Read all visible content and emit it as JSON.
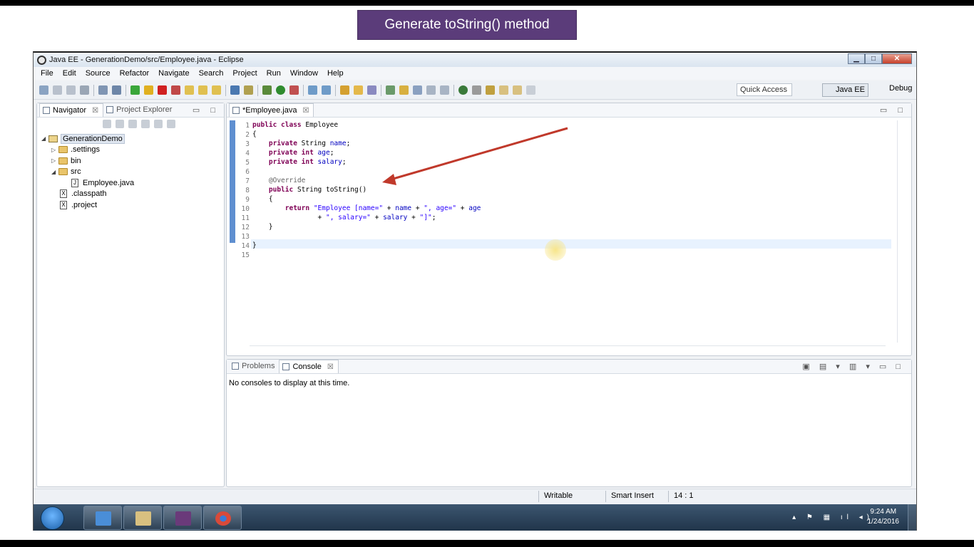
{
  "banner": {
    "text": "Generate toString() method"
  },
  "window": {
    "title": "Java EE - GenerationDemo/src/Employee.java - Eclipse"
  },
  "menu": [
    "File",
    "Edit",
    "Source",
    "Refactor",
    "Navigate",
    "Search",
    "Project",
    "Run",
    "Window",
    "Help"
  ],
  "toolbar": {
    "quick_access": "Quick Access",
    "perspective_active": "Java EE",
    "perspective_other": "Debug"
  },
  "navigator": {
    "tabs": [
      {
        "label": "Navigator",
        "close": "☒"
      },
      {
        "label": "Project Explorer"
      }
    ],
    "tree": {
      "project": "GenerationDemo",
      "settings": ".settings",
      "bin": "bin",
      "src": "src",
      "employee_file": "Employee.java",
      "classpath": ".classpath",
      "project_file": ".project"
    }
  },
  "editor": {
    "tab": {
      "label": "*Employee.java",
      "close": "☒"
    },
    "line_numbers": [
      "1",
      "2",
      "3",
      "4",
      "5",
      "6",
      "7",
      "8",
      "9",
      "10",
      "11",
      "12",
      "13",
      "14",
      "15"
    ],
    "code": {
      "l1a": "public class",
      "l1b": " Employee",
      "l2": "{",
      "l3a": "private",
      "l3b": " String ",
      "l3c": "name",
      "l3d": ";",
      "l4a": "private int",
      "l4c": "age",
      "l4d": ";",
      "l5a": "private int",
      "l5c": "salary",
      "l5d": ";",
      "l7": "@Override",
      "l8a": "public",
      "l8b": " String toString()",
      "l9": "{",
      "l10a": "return",
      "l10b": "\"Employee [name=\"",
      "l10c": " + ",
      "l10d": "name",
      "l10e": " + ",
      "l10f": "\", age=\"",
      "l10g": " + ",
      "l10h": "age",
      "l11a": "+ ",
      "l11b": "\", salary=\"",
      "l11c": " + ",
      "l11d": "salary",
      "l11e": " + ",
      "l11f": "\"]\"",
      "l11g": ";",
      "l12": "}",
      "l14": "}"
    }
  },
  "console": {
    "tabs": [
      {
        "label": "Problems"
      },
      {
        "label": "Console",
        "close": "☒"
      }
    ],
    "message": "No consoles to display at this time."
  },
  "status": {
    "writable": "Writable",
    "insert_mode": "Smart Insert",
    "position": "14 : 1"
  },
  "taskbar": {
    "time": "9:24 AM",
    "date": "1/24/2016"
  },
  "colors": {
    "banner_bg": "#5b3c7a",
    "keyword": "#7f0055",
    "field": "#0000c0",
    "string": "#2a00ff",
    "arrow": "#c0392b"
  }
}
